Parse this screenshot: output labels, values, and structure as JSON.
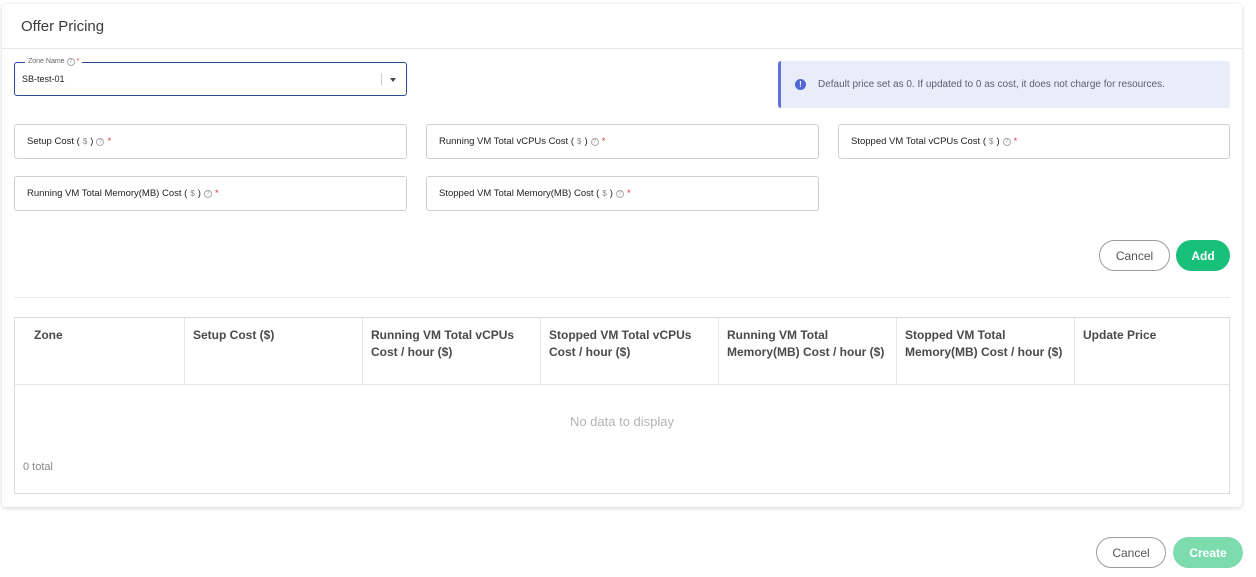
{
  "card": {
    "title": "Offer Pricing"
  },
  "zone": {
    "label": "Zone Name",
    "required_mark": "*",
    "value": "SB-test-01"
  },
  "info": {
    "icon": "info-icon",
    "text": "Default price set as 0. If updated to 0 as cost, it does not charge for resources."
  },
  "fields": {
    "setup_cost": {
      "label": "Setup Cost (",
      "unit": "$",
      "close": ")",
      "required_mark": "*"
    },
    "running_vcpus": {
      "label": "Running VM Total vCPUs Cost (",
      "unit": "$",
      "close": ")",
      "required_mark": "*"
    },
    "stopped_vcpus": {
      "label": "Stopped VM Total vCPUs Cost (",
      "unit": "$",
      "close": ")",
      "required_mark": "*"
    },
    "running_memory": {
      "label": "Running VM Total Memory(MB) Cost (",
      "unit": "$",
      "close": ")",
      "required_mark": "*"
    },
    "stopped_memory": {
      "label": "Stopped VM Total Memory(MB) Cost (",
      "unit": "$",
      "close": ")",
      "required_mark": "*"
    }
  },
  "form_actions": {
    "cancel": "Cancel",
    "add": "Add"
  },
  "table": {
    "columns": [
      "Zone",
      "Setup Cost ($)",
      "Running VM Total vCPUs Cost / hour ($)",
      "Stopped VM Total vCPUs Cost / hour ($)",
      "Running VM Total Memory(MB) Cost / hour ($)",
      "Stopped VM Total Memory(MB) Cost / hour ($)",
      "Update Price"
    ],
    "empty_text": "No data to display",
    "total_text": "0 total"
  },
  "footer": {
    "cancel": "Cancel",
    "create": "Create"
  },
  "colors": {
    "primary": "#18c07a",
    "primary_light": "#7ddcae",
    "info_accent": "#5c73d9",
    "select_border": "#2d4a9a",
    "required": "#e0383e"
  }
}
